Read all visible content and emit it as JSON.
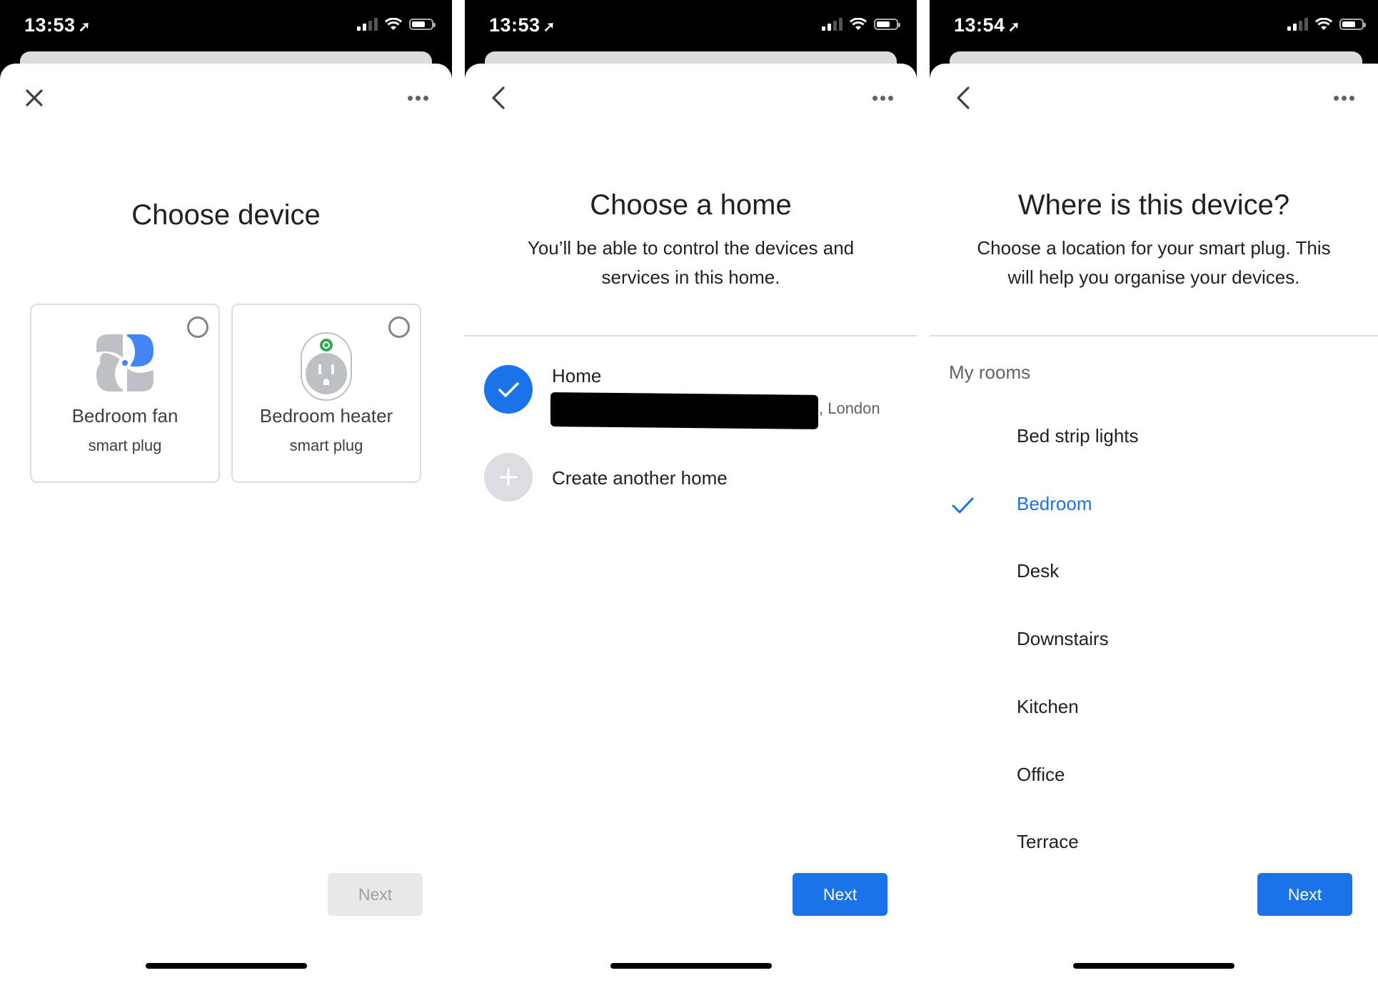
{
  "screens": [
    {
      "status": {
        "time": "13:53",
        "location_icon": "location-arrow-icon",
        "signal_bars_on": 2,
        "battery_level": 0.7
      },
      "header": {
        "left_icon": "close-icon",
        "right_icon": "more-horizontal-icon"
      },
      "title": "Choose device",
      "devices": [
        {
          "name": "Bedroom fan",
          "type": "smart plug",
          "icon": "fan-icon",
          "selected": false
        },
        {
          "name": "Bedroom heater",
          "type": "smart plug",
          "icon": "plug-icon",
          "selected": false
        }
      ],
      "next_label": "Next",
      "next_enabled": false
    },
    {
      "status": {
        "time": "13:53",
        "location_icon": "location-arrow-icon",
        "signal_bars_on": 2,
        "battery_level": 0.7
      },
      "header": {
        "left_icon": "back-icon",
        "right_icon": "more-horizontal-icon"
      },
      "title": "Choose a home",
      "subtitle_line1": "You’ll be able to control the devices and",
      "subtitle_line2": "services in this home.",
      "homes": [
        {
          "name": "Home",
          "address_suffix": ", London",
          "selected": true,
          "address_redacted": true
        }
      ],
      "create_label": "Create another home",
      "next_label": "Next",
      "next_enabled": true
    },
    {
      "status": {
        "time": "13:54",
        "location_icon": "location-arrow-icon",
        "signal_bars_on": 2,
        "battery_level": 0.7
      },
      "header": {
        "left_icon": "back-icon",
        "right_icon": "more-horizontal-icon"
      },
      "title": "Where is this device?",
      "subtitle_line1": "Choose a location for your smart plug. This",
      "subtitle_line2": "will help you organise your devices.",
      "section_label": "My rooms",
      "rooms": [
        {
          "label": "Bed strip lights",
          "selected": false
        },
        {
          "label": "Bedroom",
          "selected": true
        },
        {
          "label": "Desk",
          "selected": false
        },
        {
          "label": "Downstairs",
          "selected": false
        },
        {
          "label": "Kitchen",
          "selected": false
        },
        {
          "label": "Office",
          "selected": false
        },
        {
          "label": "Terrace",
          "selected": false
        }
      ],
      "next_label": "Next",
      "next_enabled": true
    }
  ],
  "colors": {
    "accent": "#1a73e8",
    "disabled_bg": "#e8e8e8",
    "disabled_text": "#9aa0a6",
    "divider": "#dadce0",
    "plug_led": "#34a853"
  }
}
